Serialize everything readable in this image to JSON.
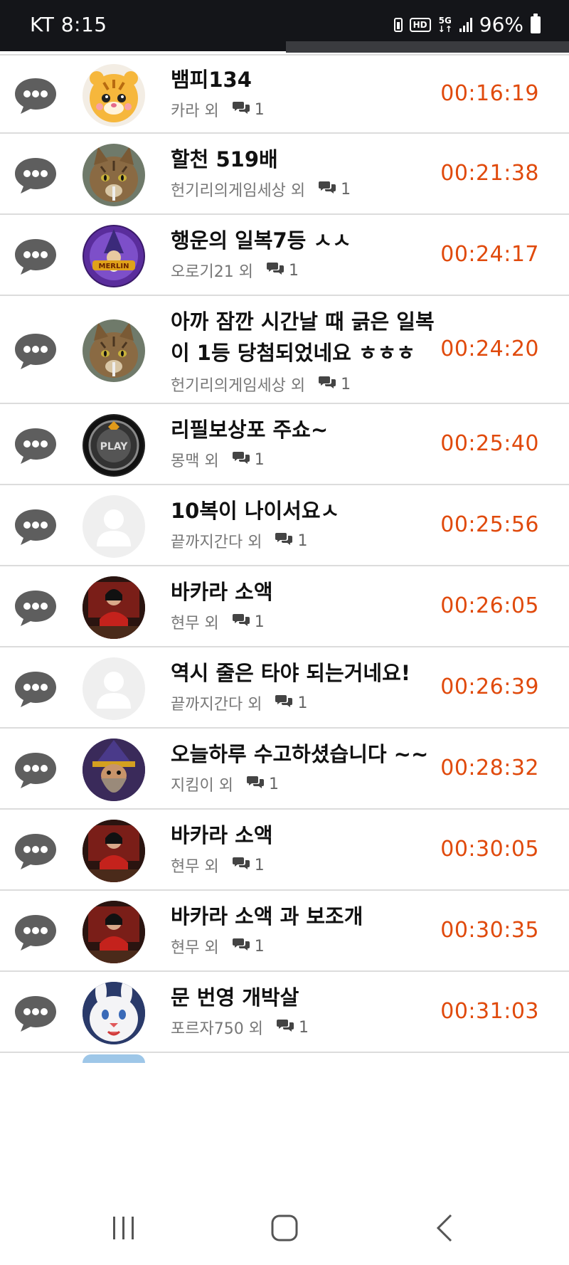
{
  "status": {
    "carrier_time": "KT 8:15",
    "battery": "96%",
    "hd": "HD",
    "net": "5G"
  },
  "colors": {
    "time": "#e04a0c",
    "status_bg": "#141519",
    "divider": "#dcdcdc"
  },
  "rows": [
    {
      "title": "뱀피134",
      "author": "카라",
      "suffix": "외",
      "count": "1",
      "time": "00:16:19",
      "avatar": "tiger"
    },
    {
      "title": "할천 519배",
      "author": "헌기리의게임세상",
      "suffix": "외",
      "count": "1",
      "time": "00:21:38",
      "avatar": "cat"
    },
    {
      "title": "행운의 일복7등 ㅅㅅ",
      "author": "오로기21",
      "suffix": "외",
      "count": "1",
      "time": "00:24:17",
      "avatar": "merlin"
    },
    {
      "title": "아까 잠깐 시간날 때 긁은 일복\n이 1등 당첨되었네요 ㅎㅎㅎ",
      "author": "헌기리의게임세상",
      "suffix": "외",
      "count": "1",
      "time": "00:24:20",
      "avatar": "cat"
    },
    {
      "title": "리필보상포 주쇼~",
      "author": "몽맥",
      "suffix": "외",
      "count": "1",
      "time": "00:25:40",
      "avatar": "play"
    },
    {
      "title": "10복이 나이서요ㅅ",
      "author": "끝까지간다",
      "suffix": "외",
      "count": "1",
      "time": "00:25:56",
      "avatar": "blank"
    },
    {
      "title": "바카라 소액",
      "author": "현무",
      "suffix": "외",
      "count": "1",
      "time": "00:26:05",
      "avatar": "dealer"
    },
    {
      "title": "역시 줄은 타야 되는거네요!",
      "author": "끝까지간다",
      "suffix": "외",
      "count": "1",
      "time": "00:26:39",
      "avatar": "blank"
    },
    {
      "title": "오늘하루 수고하셨습니다 ~~",
      "author": "지킴이",
      "suffix": "외",
      "count": "1",
      "time": "00:28:32",
      "avatar": "wizard"
    },
    {
      "title": "바카라 소액",
      "author": "현무",
      "suffix": "외",
      "count": "1",
      "time": "00:30:05",
      "avatar": "dealer"
    },
    {
      "title": "바카라 소액 과 보조개",
      "author": "현무",
      "suffix": "외",
      "count": "1",
      "time": "00:30:35",
      "avatar": "dealer"
    },
    {
      "title": "문 번영 개박살",
      "author": "포르자750",
      "suffix": "외",
      "count": "1",
      "time": "00:31:03",
      "avatar": "rabbit"
    }
  ],
  "nav": {
    "recent": "recent-apps-icon",
    "home": "home-icon",
    "back": "back-icon"
  }
}
